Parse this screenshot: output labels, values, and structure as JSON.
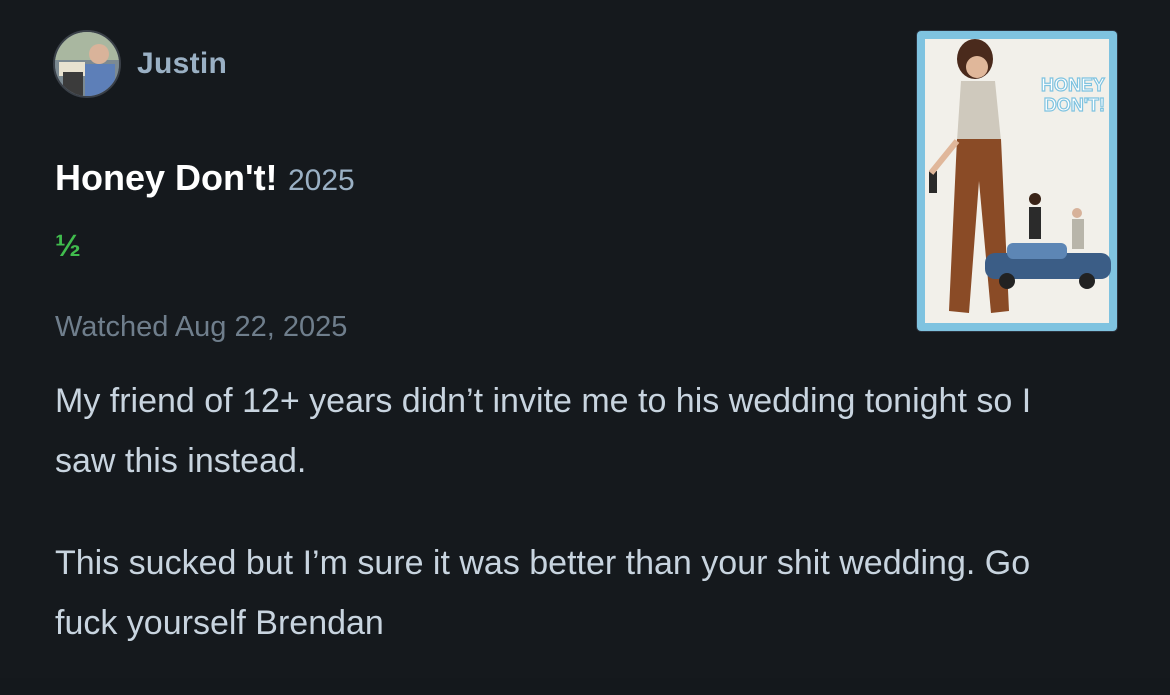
{
  "author": {
    "name": "Justin"
  },
  "film": {
    "title": "Honey Don't!",
    "year": "2025",
    "poster_title": [
      "HONEY",
      "DON'T!"
    ]
  },
  "rating": "½",
  "watched_text": "Watched Aug 22, 2025",
  "review": {
    "paragraphs": [
      "My friend of 12+ years didn’t invite me to his wedding tonight so I saw this instead.",
      "This sucked but I’m sure it was better than your shit wedding. Go fuck yourself Brendan"
    ]
  },
  "colors": {
    "background": "#15191d",
    "rating_green": "#40bc4d",
    "author_blue": "#9ab0c4",
    "meta_grey": "#6f7e8c",
    "body_text": "#c8d4df"
  }
}
